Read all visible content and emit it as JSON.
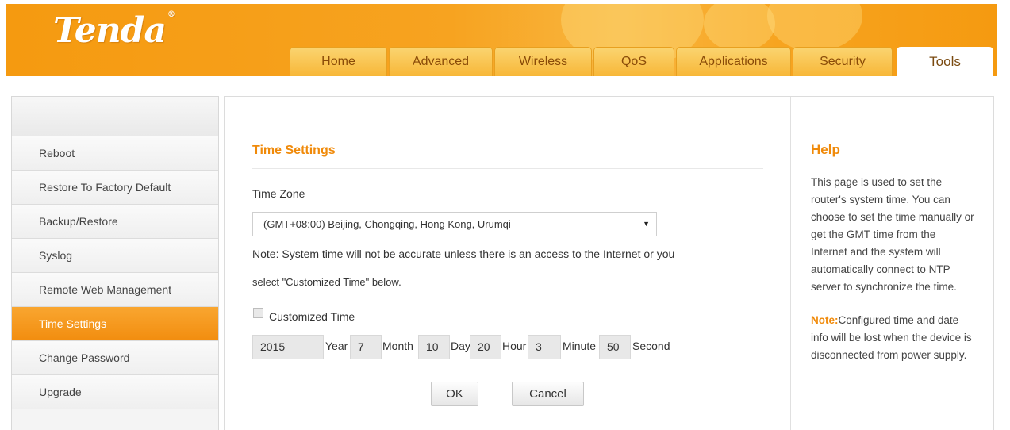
{
  "brand": {
    "logo_text": "Tenda",
    "accent_color": "#f59a10"
  },
  "tabs": [
    {
      "label": "Home"
    },
    {
      "label": "Advanced"
    },
    {
      "label": "Wireless"
    },
    {
      "label": "QoS"
    },
    {
      "label": "Applications"
    },
    {
      "label": "Security"
    },
    {
      "label": "Tools",
      "active": true
    }
  ],
  "sidebar": {
    "items": [
      {
        "label": "Reboot"
      },
      {
        "label": "Restore To Factory Default"
      },
      {
        "label": "Backup/Restore"
      },
      {
        "label": "Syslog"
      },
      {
        "label": "Remote Web Management"
      },
      {
        "label": "Time Settings",
        "active": true
      },
      {
        "label": "Change Password"
      },
      {
        "label": "Upgrade"
      }
    ]
  },
  "main": {
    "title": "Time Settings",
    "time_zone_label": "Time Zone",
    "time_zone_value": "(GMT+08:00) Beijing, Chongqing, Hong Kong, Urumqi",
    "note_line1": "Note: System time will not be accurate unless there is an access to the Internet or you",
    "note_line2": "select \"Customized Time\" below.",
    "customized_label": "Customized Time",
    "customized_checked": false,
    "year_value": "2015",
    "year_label": "Year",
    "month_value": "7",
    "month_label": "Month",
    "day_value": "10",
    "day_label": "Day",
    "hour_value": "20",
    "hour_label": "Hour",
    "minute_value": "3",
    "minute_label": "Minute",
    "second_value": "50",
    "second_label": "Second",
    "ok_label": "OK",
    "cancel_label": "Cancel"
  },
  "help": {
    "title": "Help",
    "text": "This page is used to set the router's system time. You can choose to set the time manually or get the GMT time from the Internet and the system will automatically connect to NTP server to synchronize the time.",
    "note_label": "Note:",
    "note_text": "Configured time and date info will be lost when the device is disconnected from power supply."
  }
}
